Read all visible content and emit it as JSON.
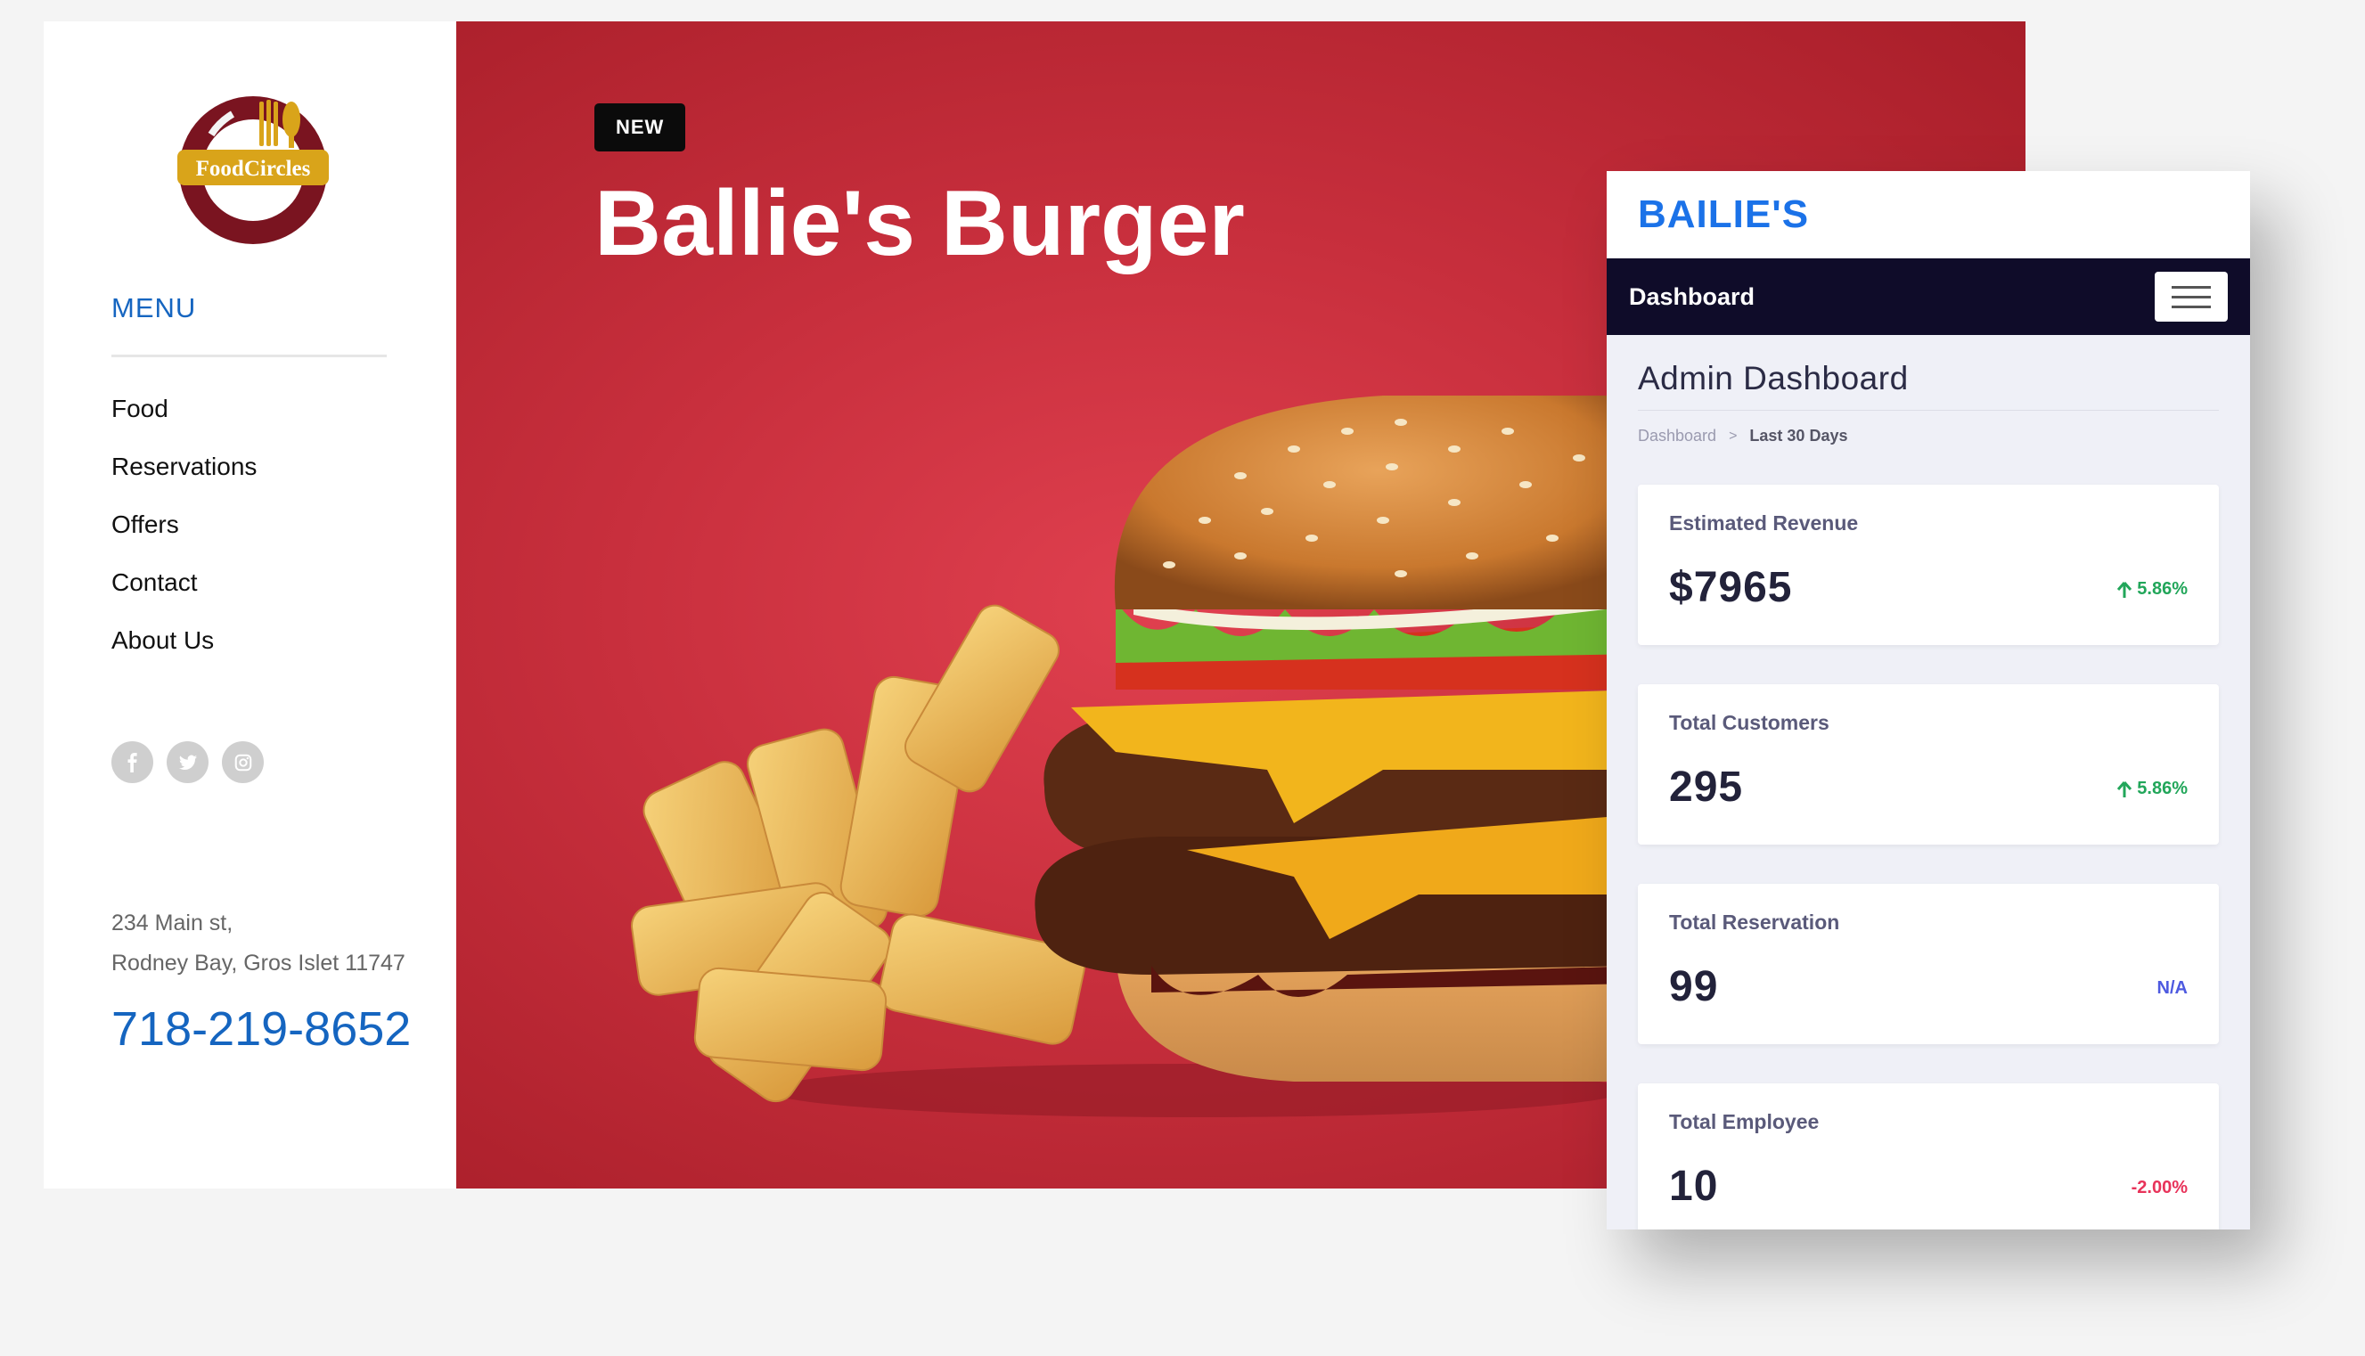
{
  "site": {
    "logo_text": "FoodCircles",
    "menu_title": "MENU",
    "menu_items": [
      {
        "label": "Food"
      },
      {
        "label": "Reservations"
      },
      {
        "label": "Offers"
      },
      {
        "label": "Contact"
      },
      {
        "label": "About Us"
      }
    ],
    "social_icons": [
      "facebook-icon",
      "twitter-icon",
      "instagram-icon"
    ],
    "address_line1": "234 Main st,",
    "address_line2": "Rodney Bay, Gros Islet 11747",
    "phone": "718-219-8652",
    "hero_badge": "NEW",
    "hero_title": "Ballie's Burger",
    "colors": {
      "accent": "#1565c0",
      "hero": "#c82f3d",
      "badge": "#0b0b0b"
    }
  },
  "dashboard": {
    "brand": "BAILIE'S",
    "nav_title": "Dashboard",
    "page_title": "Admin Dashboard",
    "breadcrumb": {
      "root": "Dashboard",
      "current": "Last 30 Days"
    },
    "stats": [
      {
        "label": "Estimated Revenue",
        "value": "$7965",
        "change": "5.86%",
        "trend": "up"
      },
      {
        "label": "Total Customers",
        "value": "295",
        "change": "5.86%",
        "trend": "up"
      },
      {
        "label": "Total Reservation",
        "value": "99",
        "change": "N/A",
        "trend": "neutral"
      },
      {
        "label": "Total Employee",
        "value": "10",
        "change": "-2.00%",
        "trend": "down"
      }
    ],
    "colors": {
      "brand": "#1b72e8",
      "nav": "#0f0c29",
      "up": "#22a65a",
      "neutral": "#4e5ae0",
      "down": "#e8335a"
    }
  }
}
